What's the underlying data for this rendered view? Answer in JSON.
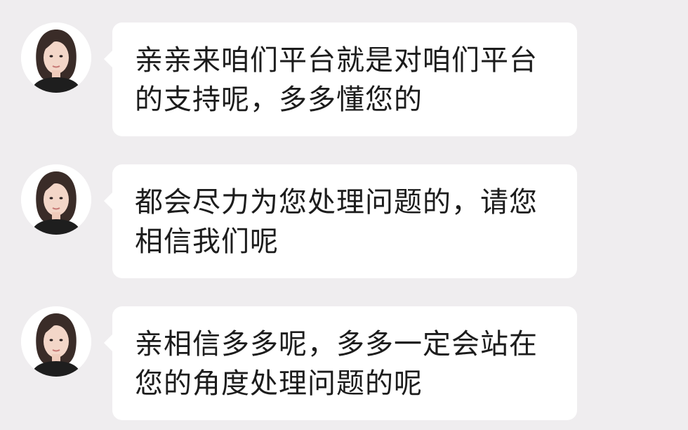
{
  "messages": [
    {
      "lines": [
        "亲亲来咱们平台就是对咱们平台",
        "的支持呢，多多懂您的"
      ],
      "avatar_icon": "agent-avatar-icon"
    },
    {
      "lines": [
        "都会尽力为您处理问题的，请您",
        "相信我们呢"
      ],
      "avatar_icon": "agent-avatar-icon"
    },
    {
      "lines": [
        "亲相信多多呢，多多一定会站在",
        "您的角度处理问题的呢"
      ],
      "avatar_icon": "agent-avatar-icon"
    }
  ],
  "colors": {
    "background": "#efedef",
    "bubble": "#ffffff",
    "text": "#1c1c1c"
  }
}
